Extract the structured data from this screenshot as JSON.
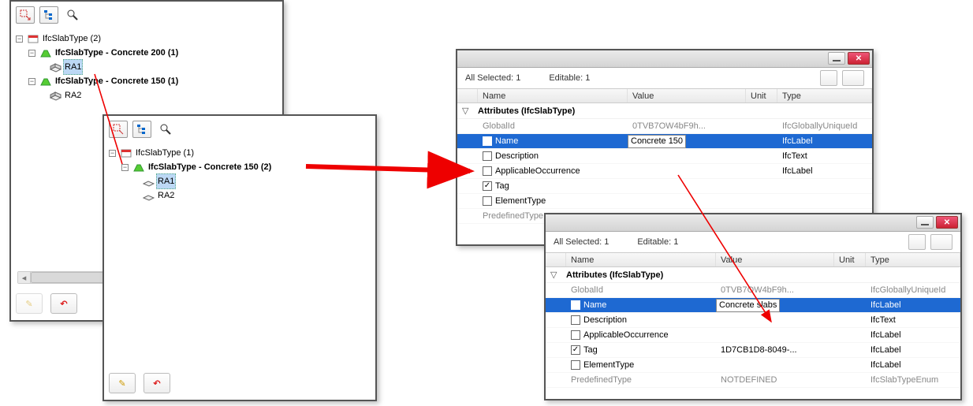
{
  "tree1": {
    "root": "IfcSlabType (2)",
    "t1": "IfcSlabType - Concrete 200 (1)",
    "e1": "RA1",
    "t2": "IfcSlabType - Concrete 150 (1)",
    "e2": "RA2"
  },
  "tree2": {
    "root": "IfcSlabType (1)",
    "t1": "IfcSlabType - Concrete 150 (2)",
    "e1": "RA1",
    "e2": "RA2"
  },
  "props": {
    "status_selected": "All Selected: 1",
    "status_editable": "Editable: 1",
    "headers": {
      "name": "Name",
      "value": "Value",
      "unit": "Unit",
      "type": "Type"
    },
    "section": "Attributes (IfcSlabType)",
    "globalid_label": "GlobalId",
    "name_label": "Name",
    "desc_label": "Description",
    "appocc_label": "ApplicableOccurrence",
    "tag_label": "Tag",
    "elemtype_label": "ElementType",
    "predef_label": "PredefinedType",
    "type_guid": "IfcGloballyUniqueId",
    "type_label": "IfcLabel",
    "type_text": "IfcText",
    "type_enum": "IfcSlabTypeEnum"
  },
  "panel1": {
    "globalid_value": "0TVB7OW4bF9h...",
    "name_value": "Concrete 150"
  },
  "panel2": {
    "globalid_value": "0TVB7OW4bF9h...",
    "name_value": "Concrete slabs",
    "tag_value": "1D7CB1D8-8049-...",
    "predef_value": "NOTDEFINED"
  }
}
